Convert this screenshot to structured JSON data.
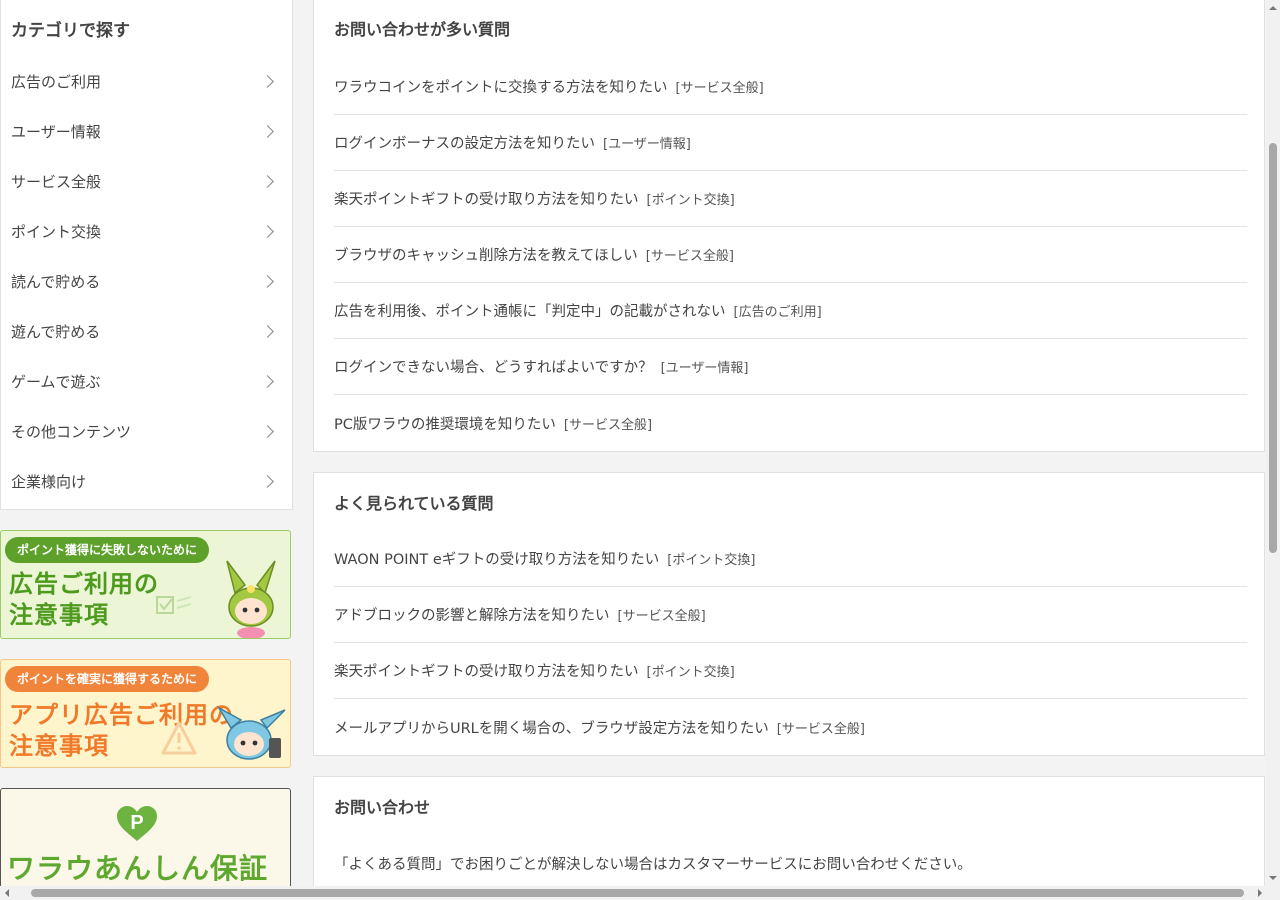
{
  "sidebar": {
    "title": "カテゴリで探す",
    "categories": [
      {
        "label": "広告のご利用"
      },
      {
        "label": "ユーザー情報"
      },
      {
        "label": "サービス全般"
      },
      {
        "label": "ポイント交換"
      },
      {
        "label": "読んで貯める"
      },
      {
        "label": "遊んで貯める"
      },
      {
        "label": "ゲームで遊ぶ"
      },
      {
        "label": "その他コンテンツ"
      },
      {
        "label": "企業様向け"
      }
    ],
    "banners": [
      {
        "pill": "ポイント獲得に失敗しないために",
        "line1": "広告ご利用の",
        "line2": "注意事項"
      },
      {
        "pill": "ポイントを確実に獲得するために",
        "line1": "アプリ広告ご利用の",
        "line2": "注意事項"
      },
      {
        "text": "ワラウあんしん保証"
      }
    ]
  },
  "popular": {
    "title": "お問い合わせが多い質問",
    "items": [
      {
        "q": "ワラウコインをポイントに交換する方法を知りたい",
        "tag": "[サービス全般]"
      },
      {
        "q": "ログインボーナスの設定方法を知りたい",
        "tag": "[ユーザー情報]"
      },
      {
        "q": "楽天ポイントギフトの受け取り方法を知りたい",
        "tag": "[ポイント交換]"
      },
      {
        "q": "ブラウザのキャッシュ削除方法を教えてほしい",
        "tag": "[サービス全般]"
      },
      {
        "q": "広告を利用後、ポイント通帳に「判定中」の記載がされない",
        "tag": "[広告のご利用]"
      },
      {
        "q": "ログインできない場合、どうすればよいですか？",
        "tag": "[ユーザー情報]"
      },
      {
        "q": "PC版ワラウの推奨環境を知りたい",
        "tag": "[サービス全般]"
      }
    ]
  },
  "viewed": {
    "title": "よく見られている質問",
    "items": [
      {
        "q": "WAON POINT eギフトの受け取り方法を知りたい",
        "tag": "[ポイント交換]"
      },
      {
        "q": "アドブロックの影響と解除方法を知りたい",
        "tag": "[サービス全般]"
      },
      {
        "q": "楽天ポイントギフトの受け取り方法を知りたい",
        "tag": "[ポイント交換]"
      },
      {
        "q": "メールアプリからURLを開く場合の、ブラウザ設定方法を知りたい",
        "tag": "[サービス全般]"
      }
    ]
  },
  "contact": {
    "title": "お問い合わせ",
    "text": "「よくある質問」でお困りごとが解決しない場合はカスタマーサービスにお問い合わせください。"
  }
}
